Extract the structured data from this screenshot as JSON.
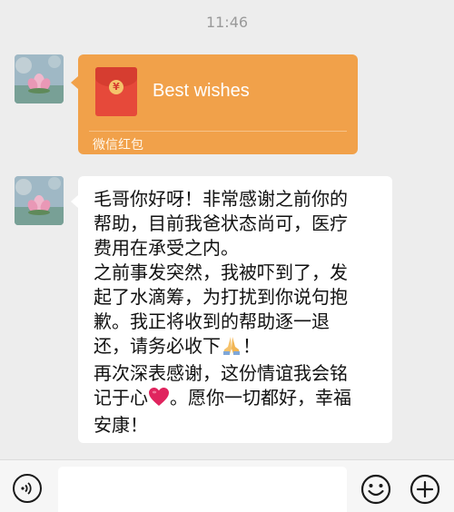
{
  "timestamp": "11:46",
  "red_packet": {
    "title": "Best wishes",
    "footer": "微信红包",
    "coin_symbol": "¥",
    "color": "#f1a14a"
  },
  "message": {
    "lines": [
      "毛哥你好呀！非常感谢之前你的",
      "帮助，目前我爸状态尚可，医疗",
      "费用在承受之内。",
      "之前事发突然，我被吓到了，发",
      "起了水滴筹，为打扰到你说句抱",
      "歉。我正将收到的帮助逐一退",
      "还，请务必收下",
      "！",
      "再次深表感谢，这份情谊我会铭",
      "记于心",
      "。愿你一切都好，幸福",
      "安康！"
    ],
    "emojis": [
      "praying-hands-icon",
      "red-heart-icon"
    ]
  },
  "input_bar": {
    "icons": [
      "voice-icon",
      "emoji-icon",
      "plus-icon"
    ]
  },
  "colors": {
    "background": "#ededed",
    "packet": "#f1a14a",
    "envelope": "#e6493a",
    "bubble": "#ffffff"
  }
}
